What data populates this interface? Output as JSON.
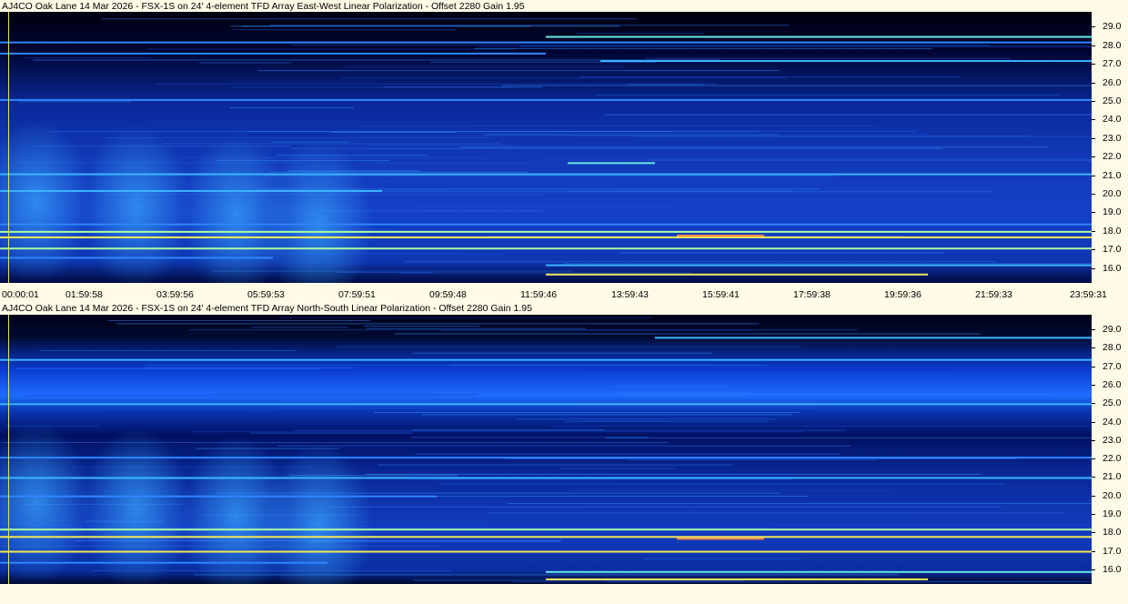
{
  "chart_data": [
    {
      "type": "heatmap",
      "title": "AJ4CO Oak Lane 14 Mar 2026 - FSX-1S on 24' 4-element TFD Array East-West Linear Polarization  -  Offset 2280  Gain 1.95",
      "xlabel": "",
      "ylabel": "",
      "ylim": [
        15.2,
        29.8
      ],
      "y_ticks": [
        "29.0",
        "28.0",
        "27.0",
        "26.0",
        "25.0",
        "24.0",
        "23.0",
        "22.0",
        "21.0",
        "20.0",
        "19.0",
        "18.0",
        "17.0",
        "16.0"
      ],
      "y_tick_values": [
        29,
        28,
        27,
        26,
        25,
        24,
        23,
        22,
        21,
        20,
        19,
        18,
        17,
        16
      ],
      "x_ticks": [
        "00:00:01",
        "01:59:58",
        "03:59:56",
        "05:59:53",
        "07:59:51",
        "09:59:48",
        "11:59:46",
        "13:59:43",
        "15:59:41",
        "17:59:38",
        "19:59:36",
        "21:59:33",
        "23:59:31"
      ],
      "lines": [
        {
          "y": 28.5,
          "i": 0.7,
          "x0": 0.5,
          "x1": 1.0
        },
        {
          "y": 28.2,
          "i": 0.5,
          "x0": 0.0,
          "x1": 1.0
        },
        {
          "y": 27.6,
          "i": 0.5,
          "x0": 0.0,
          "x1": 0.5
        },
        {
          "y": 27.2,
          "i": 0.6,
          "x0": 0.55,
          "x1": 1.0
        },
        {
          "y": 25.1,
          "i": 0.5,
          "x0": 0.0,
          "x1": 1.0
        },
        {
          "y": 21.1,
          "i": 0.6,
          "x0": 0.0,
          "x1": 1.0
        },
        {
          "y": 20.2,
          "i": 0.6,
          "x0": 0.0,
          "x1": 0.35
        },
        {
          "y": 18.4,
          "i": 0.5,
          "x0": 0.0,
          "x1": 1.0
        },
        {
          "y": 18.0,
          "i": 0.8,
          "x0": 0.0,
          "x1": 1.0
        },
        {
          "y": 17.7,
          "i": 0.9,
          "x0": 0.0,
          "x1": 1.0
        },
        {
          "y": 17.1,
          "i": 0.8,
          "x0": 0.0,
          "x1": 1.0
        },
        {
          "y": 16.6,
          "i": 0.5,
          "x0": 0.0,
          "x1": 0.25
        },
        {
          "y": 16.2,
          "i": 0.6,
          "x0": 0.5,
          "x1": 1.0
        },
        {
          "y": 15.7,
          "i": 0.9,
          "x0": 0.5,
          "x1": 0.85
        },
        {
          "y": 21.7,
          "i": 0.7,
          "x0": 0.52,
          "x1": 0.6
        },
        {
          "y": 17.8,
          "i": 1.0,
          "x0": 0.62,
          "x1": 0.7
        }
      ]
    },
    {
      "type": "heatmap",
      "title": "AJ4CO Oak Lane 14 Mar 2026 - FSX-1S on 24' 4-element TFD Array North-South Linear Polarization  -  Offset 2280  Gain 1.95",
      "xlabel": "",
      "ylabel": "",
      "ylim": [
        15.2,
        29.8
      ],
      "y_ticks": [
        "29.0",
        "28.0",
        "27.0",
        "26.0",
        "25.0",
        "24.0",
        "23.0",
        "22.0",
        "21.0",
        "20.0",
        "19.0",
        "18.0",
        "17.0",
        "16.0"
      ],
      "y_tick_values": [
        29,
        28,
        27,
        26,
        25,
        24,
        23,
        22,
        21,
        20,
        19,
        18,
        17,
        16
      ],
      "lines": [
        {
          "y": 28.6,
          "i": 0.6,
          "x0": 0.6,
          "x1": 1.0
        },
        {
          "y": 27.4,
          "i": 0.6,
          "x0": 0.0,
          "x1": 1.0
        },
        {
          "y": 25.0,
          "i": 0.6,
          "x0": 0.0,
          "x1": 1.0
        },
        {
          "y": 22.1,
          "i": 0.5,
          "x0": 0.0,
          "x1": 1.0
        },
        {
          "y": 21.0,
          "i": 0.6,
          "x0": 0.0,
          "x1": 1.0
        },
        {
          "y": 20.0,
          "i": 0.5,
          "x0": 0.0,
          "x1": 0.4
        },
        {
          "y": 18.2,
          "i": 0.8,
          "x0": 0.0,
          "x1": 1.0
        },
        {
          "y": 17.8,
          "i": 0.9,
          "x0": 0.0,
          "x1": 1.0
        },
        {
          "y": 17.0,
          "i": 0.9,
          "x0": 0.0,
          "x1": 1.0
        },
        {
          "y": 16.4,
          "i": 0.5,
          "x0": 0.0,
          "x1": 0.3
        },
        {
          "y": 15.9,
          "i": 0.7,
          "x0": 0.5,
          "x1": 1.0
        },
        {
          "y": 15.5,
          "i": 0.9,
          "x0": 0.5,
          "x1": 0.85
        },
        {
          "y": 17.7,
          "i": 1.0,
          "x0": 0.62,
          "x1": 0.7
        }
      ]
    }
  ],
  "colors": {
    "background": "#fffbe6",
    "colormap": [
      "#000010",
      "#000a4a",
      "#0a2ea8",
      "#1a58e0",
      "#2e86ff",
      "#3fc0ff",
      "#7fffd0",
      "#f0ff60",
      "#ff9040"
    ]
  }
}
